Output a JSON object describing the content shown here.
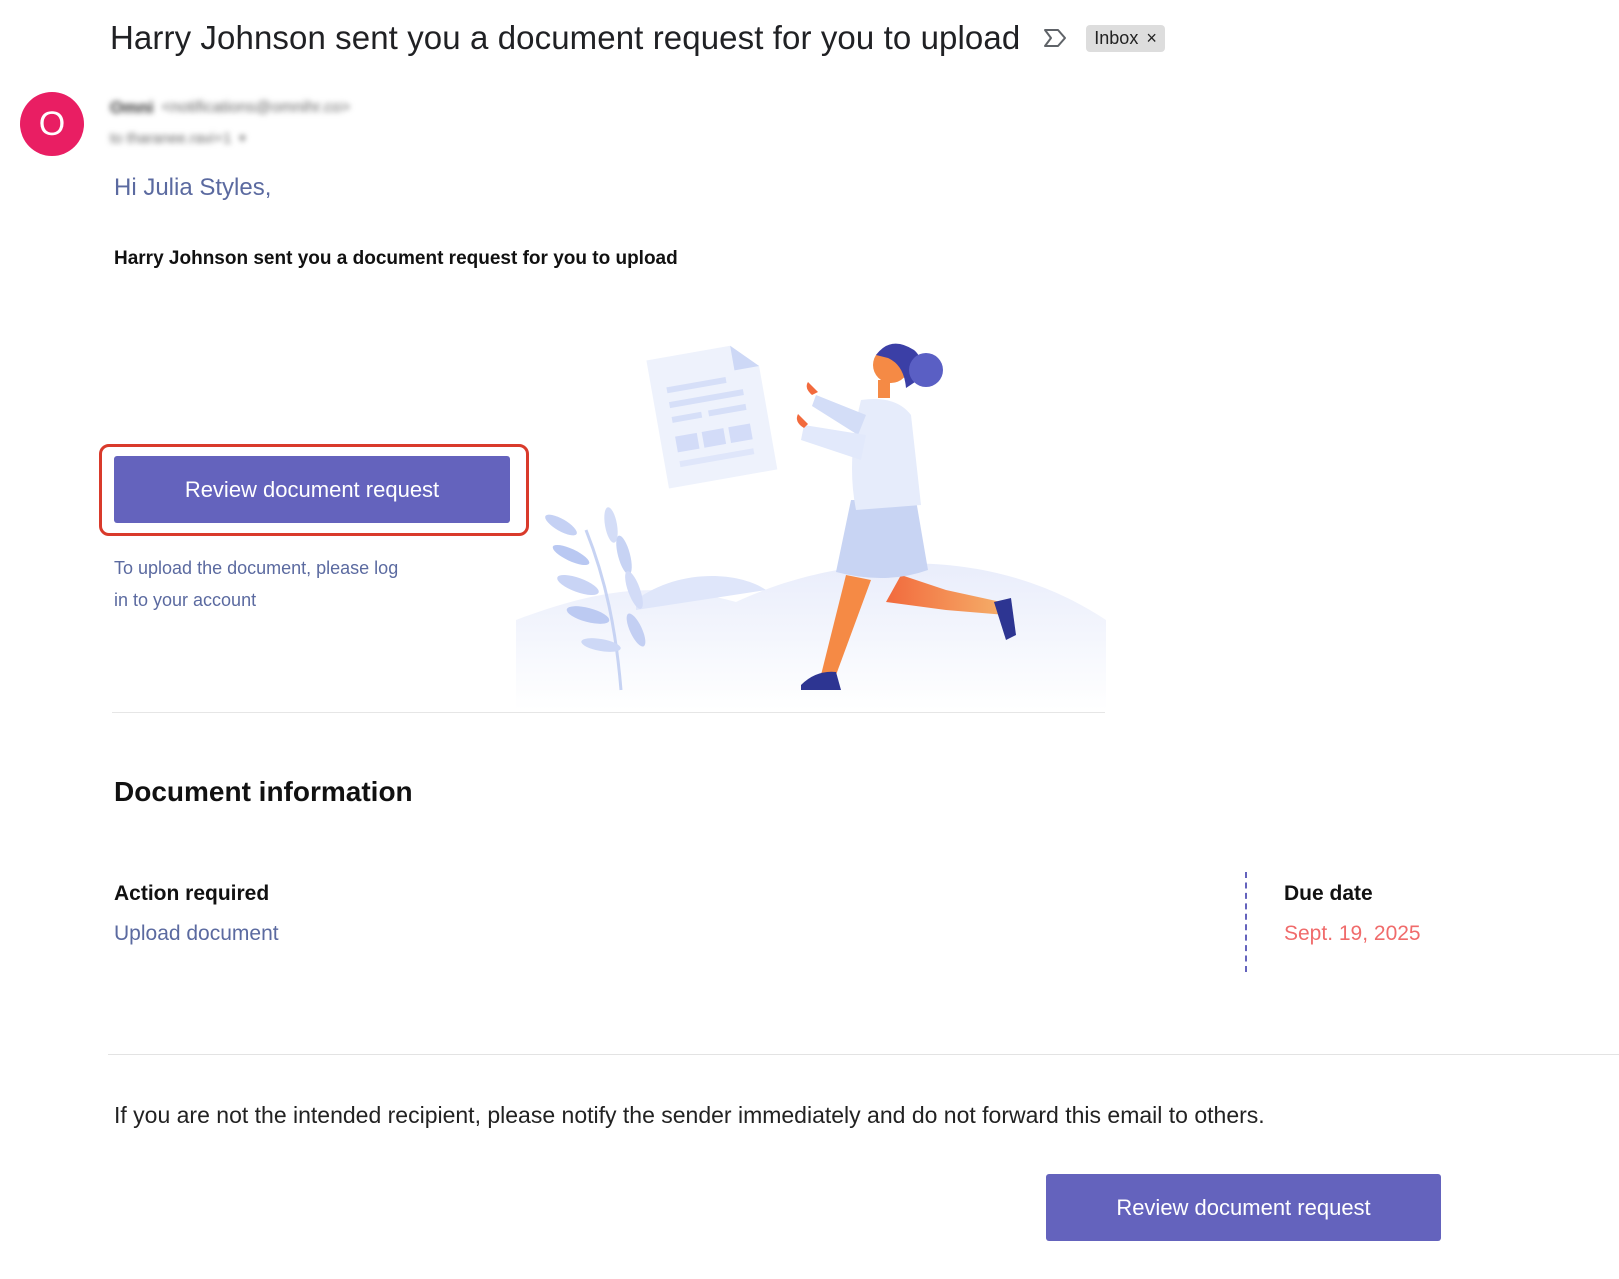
{
  "header": {
    "subject": "Harry Johnson sent you a document request for you to upload",
    "importance_icon": "importance-marker-icon",
    "label": "Inbox",
    "label_remove": "×"
  },
  "sender": {
    "avatar_initial": "O",
    "avatar_color": "#e91e63",
    "name": "Omni",
    "email": "<notifications@omnihr.co>",
    "to": "to tharanee.ravi+1",
    "to_caret": "▾"
  },
  "body": {
    "greeting": "Hi Julia Styles,",
    "intro": "Harry Johnson sent you a document request for you to upload",
    "cta_label": "Review document request",
    "login_hint": "To upload the document, please log in to your account"
  },
  "document_info": {
    "heading": "Document information",
    "action_label": "Action required",
    "action_value": "Upload document",
    "due_label": "Due date",
    "due_value": "Sept. 19, 2025"
  },
  "footer": {
    "notice": "If you are not the intended recipient, please notify the sender immediately and do not forward this email to others.",
    "cta_label": "Review document request"
  },
  "colors": {
    "accent": "#6463bd",
    "link_text": "#5b6aa0",
    "due_date": "#f06b6b",
    "highlight": "#d93a2b"
  }
}
